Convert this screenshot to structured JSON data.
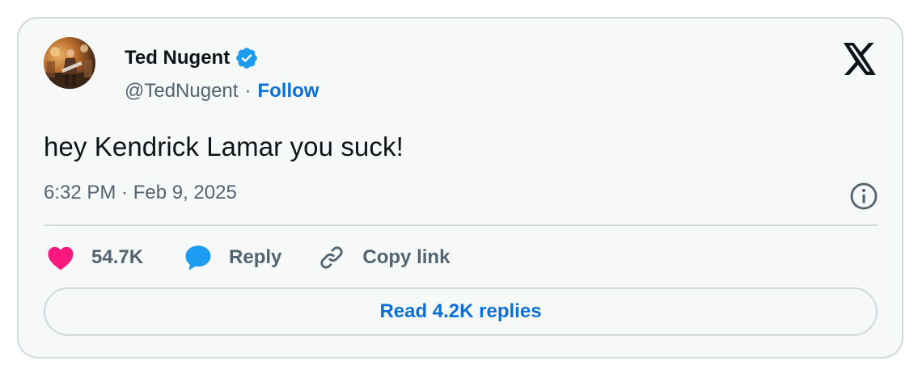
{
  "author": {
    "display_name": "Ted Nugent",
    "handle": "@TedNugent",
    "separator": "·",
    "follow_label": "Follow",
    "verified": true
  },
  "tweet": {
    "text": "hey Kendrick Lamar you suck!",
    "timestamp": "6:32 PM · Feb 9, 2025"
  },
  "actions": {
    "like_count": "54.7K",
    "reply_label": "Reply",
    "copy_link_label": "Copy link"
  },
  "read_replies_label": "Read 4.2K replies",
  "icons": {
    "brand": "x-logo-icon",
    "verified": "verified-badge-icon",
    "info": "info-icon",
    "like": "heart-icon",
    "reply": "speech-bubble-icon",
    "copy": "link-icon"
  },
  "colors": {
    "accent": "#0a70d8",
    "verified_badge": "#1d9bf0",
    "heart": "#f91880",
    "secondary_text": "#536471",
    "card_bg": "#f7f9f9",
    "border": "#cfd9de"
  }
}
